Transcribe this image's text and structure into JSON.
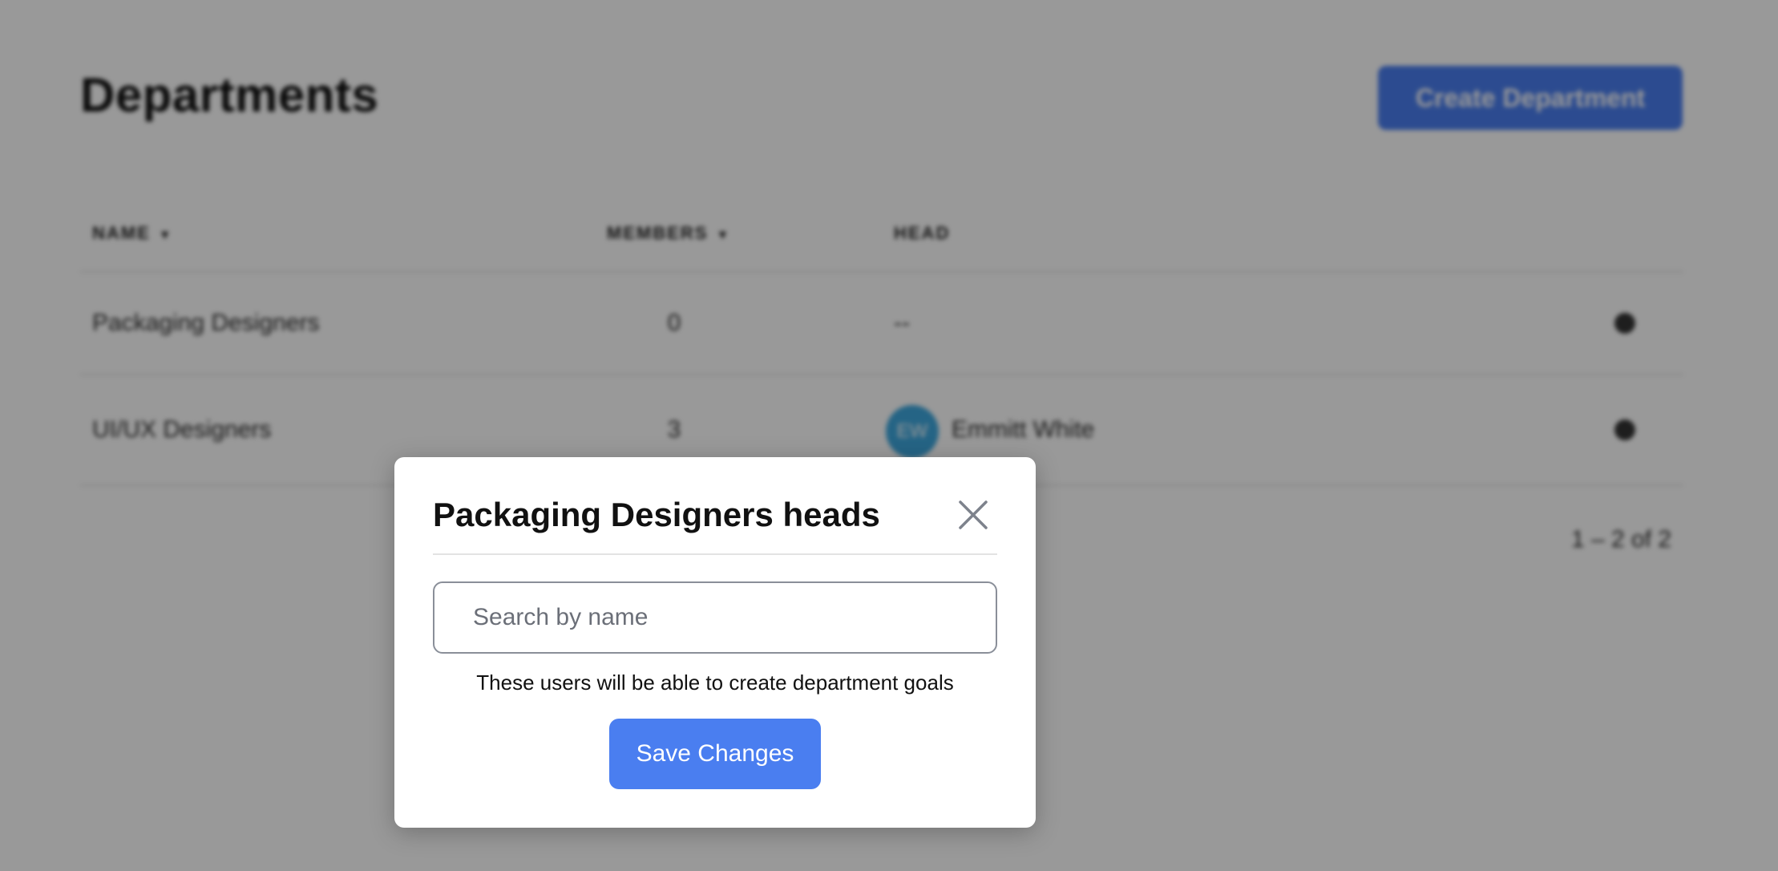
{
  "page": {
    "title": "Departments",
    "create_button_label": "Create Department"
  },
  "table": {
    "headers": {
      "name": "NAME",
      "members": "MEMBERS",
      "head": "HEAD"
    },
    "sort_icon": "caret-down-icon",
    "rows": [
      {
        "name": "Packaging Designers",
        "members": "0",
        "head": "--",
        "head_initials": ""
      },
      {
        "name": "UI/UX Designers",
        "members": "3",
        "head": "Emmitt White",
        "head_initials": "EW"
      }
    ],
    "row_action_icon": "gear-icon",
    "pagination": "1 – 2 of 2"
  },
  "modal": {
    "title": "Packaging Designers heads",
    "close_icon": "close-icon",
    "search_placeholder": "Search by name",
    "search_value": "",
    "helper_text": "These users will be able to create department goals",
    "save_label": "Save Changes"
  },
  "colors": {
    "accent": "#4a7ef0",
    "avatar": "#3ea7de",
    "overlay": "rgba(0,0,0,0.4)"
  }
}
